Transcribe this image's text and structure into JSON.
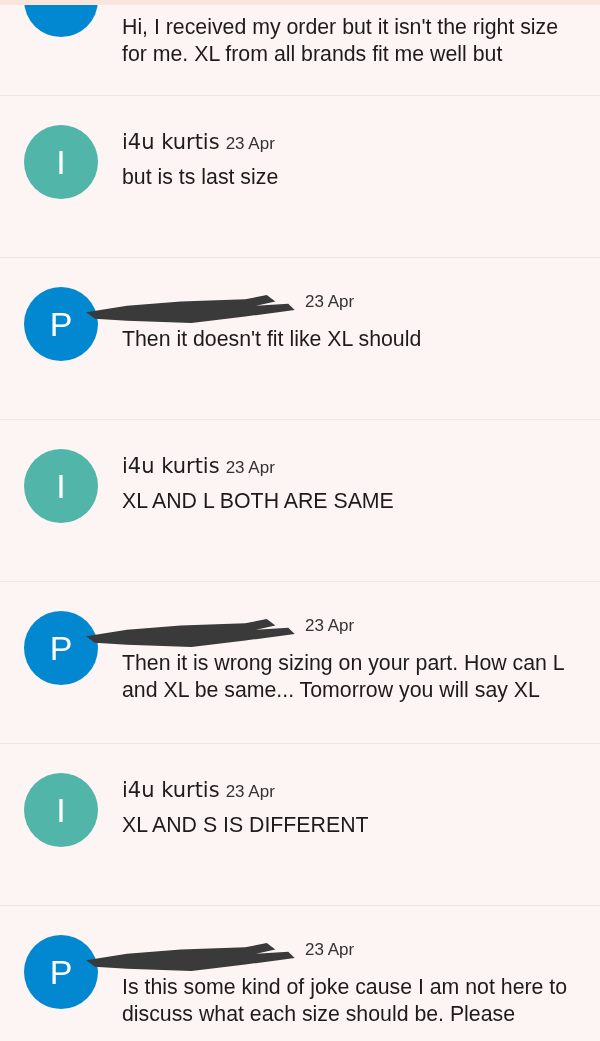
{
  "messages": [
    {
      "avatar": {
        "color": "#0288d1"
      },
      "message": "Hi, I received my order but it isn't the right size for me. XL from all brands fit me well but"
    },
    {
      "avatar": {
        "letter": "I",
        "color": "#52b5a9"
      },
      "redacted": false,
      "sender": "i4u kurtis",
      "date": "23 Apr",
      "message": "but is ts last size"
    },
    {
      "avatar": {
        "letter": "P",
        "color": "#0288d1"
      },
      "redacted": true,
      "date": "23 Apr",
      "message": "Then it doesn't fit like XL should"
    },
    {
      "avatar": {
        "letter": "I",
        "color": "#52b5a9"
      },
      "redacted": false,
      "sender": "i4u kurtis",
      "date": "23 Apr",
      "message": "XL AND L BOTH ARE SAME"
    },
    {
      "avatar": {
        "letter": "P",
        "color": "#0288d1"
      },
      "redacted": true,
      "date": "23 Apr",
      "message": "Then it is wrong sizing on your part. How can L and XL be same... Tomorrow you will say XL"
    },
    {
      "avatar": {
        "letter": "I",
        "color": "#52b5a9"
      },
      "redacted": false,
      "sender": "i4u kurtis",
      "date": "23 Apr",
      "message": "XL AND S IS DIFFERENT"
    },
    {
      "avatar": {
        "letter": "P",
        "color": "#0288d1"
      },
      "redacted": true,
      "date": "23 Apr",
      "message": "Is this some kind of joke cause I am not here to discuss what each size should be. Please"
    }
  ]
}
